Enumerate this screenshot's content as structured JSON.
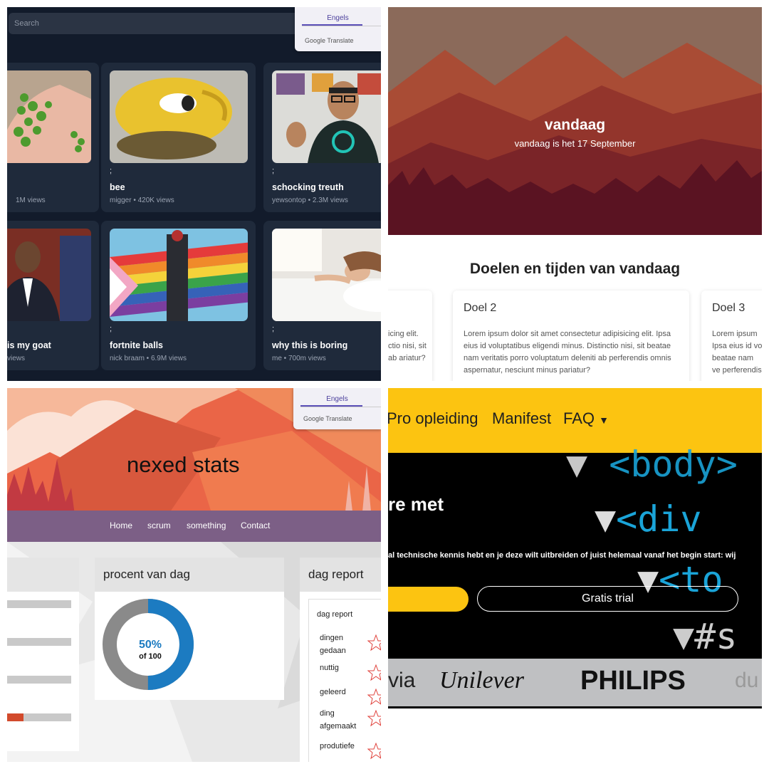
{
  "q1": {
    "search_placeholder": "Search",
    "translate": {
      "language": "Engels",
      "brand": "Google Translate"
    },
    "videos": [
      {
        "semi": "",
        "title": "",
        "meta": "1M views"
      },
      {
        "semi": ";",
        "title": "bee",
        "meta": "migger • 420K views"
      },
      {
        "semi": ";",
        "title": "schocking treuth",
        "meta": "yewsontop • 2.3M views"
      },
      {
        "semi": "",
        "title": "is my goat",
        "meta": "views"
      },
      {
        "semi": ";",
        "title": "fortnite balls",
        "meta": "nick braam • 6.9M views"
      },
      {
        "semi": ";",
        "title": "why this is boring",
        "meta": "me • 700m views"
      }
    ]
  },
  "q2": {
    "hero_title": "vandaag",
    "hero_subtitle": "vandaag is het 17 September",
    "section_heading": "Doelen en tijden van vandaag",
    "goals": [
      {
        "title": "",
        "body": "icing elit. ctio nisi, sit ab ariatur?"
      },
      {
        "title": "Doel 2",
        "body": "Lorem ipsum dolor sit amet consectetur adipisicing elit. Ipsa eius id voluptatibus eligendi minus. Distinctio nisi, sit beatae nam veritatis porro voluptatum deleniti ab perferendis omnis aspernatur, nesciunt minus pariatur?"
      },
      {
        "title": "Doel 3",
        "body": "Lorem ipsum Ipsa eius id vo beatae nam ve perferendis om"
      }
    ]
  },
  "q3": {
    "translate": {
      "language": "Engels",
      "brand": "Google Translate"
    },
    "title": "nexed stats",
    "nav": [
      "Home",
      "scrum",
      "something",
      "Contact"
    ],
    "progress_panel": {
      "title": "procent van dag",
      "percent_label": "50%",
      "of_label": "of 100",
      "percent_value": 50
    },
    "report_panel": {
      "title": "dag report",
      "list_title": "dag report",
      "items": [
        "dingen gedaan",
        "nuttig",
        "geleerd",
        "ding afgemaakt",
        "produtiefe"
      ]
    },
    "bars": [
      0,
      0,
      0,
      0.25
    ],
    "colors": {
      "donut_fill": "#1c7bc1",
      "donut_empty": "#8a8a8a",
      "bar_fill": "#d24a2c",
      "star": "#e0433d"
    }
  },
  "q4": {
    "nav": [
      "Pro opleiding",
      "Manifest",
      "FAQ"
    ],
    "headline": "re met",
    "intro": "al technische kennis hebt en je deze wilt uitbreiden of juist helemaal vanaf het begin start: wij",
    "trial_button": "Gratis trial",
    "code_lines": [
      "<body>",
      "<div",
      "<to",
      "#s"
    ],
    "logos": [
      "via",
      "Unilever",
      "PHILIPS",
      "du"
    ],
    "colors": {
      "accent": "#fcc411",
      "code": "#1aa4d8"
    }
  }
}
